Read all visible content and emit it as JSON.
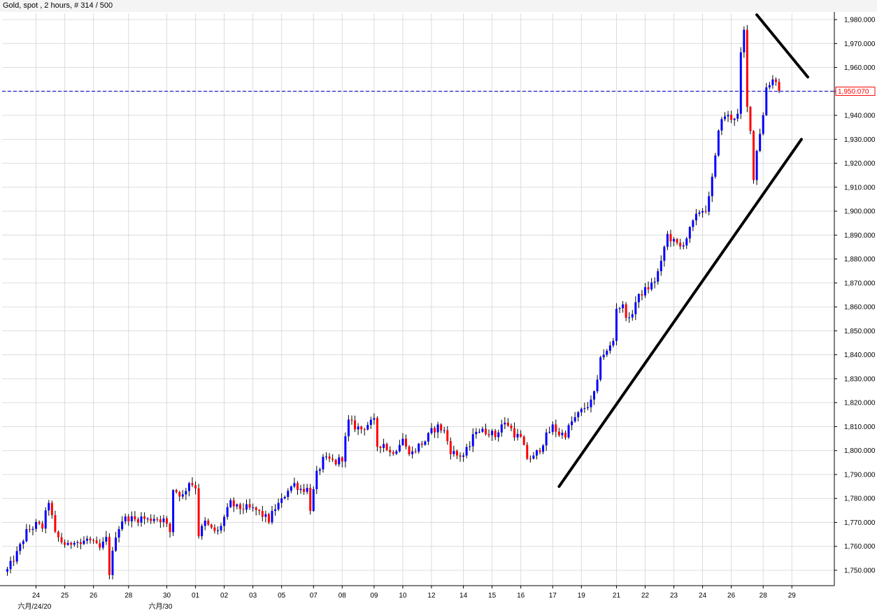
{
  "header": {
    "title": "Gold, spot , 2 hours, # 314 / 500"
  },
  "colors": {
    "bull": "#0000ff",
    "bear": "#ff0000",
    "wick": "#000000",
    "grid": "#dcdcdc",
    "price_line": "#0000cc",
    "trendline": "#000000"
  },
  "chart_data": {
    "type": "candlestick",
    "symbol": "Gold, spot",
    "timeframe": "2 hours",
    "ylim": [
      1743,
      1983
    ],
    "y_ticks": [
      1750,
      1760,
      1770,
      1780,
      1790,
      1800,
      1810,
      1820,
      1830,
      1840,
      1850,
      1860,
      1870,
      1880,
      1890,
      1900,
      1910,
      1920,
      1930,
      1940,
      1950,
      1960,
      1970,
      1980
    ],
    "y_tick_labels": [
      "1,750.000",
      "1,760.000",
      "1,770.000",
      "1,780.000",
      "1,790.000",
      "1,800.000",
      "1,810.000",
      "1,820.000",
      "1,830.000",
      "1,840.000",
      "1,850.000",
      "1,860.000",
      "1,870.000",
      "1,880.000",
      "1,890.000",
      "1,900.000",
      "1,910.000",
      "1,920.000",
      "1,930.000",
      "1,940.000",
      "1,950.000",
      "1,960.000",
      "1,970.000",
      "1,980.000"
    ],
    "current_price": 1950.07,
    "current_price_label": "1,950.070",
    "x_ticks": [
      "24",
      "25",
      "26",
      "28",
      "30",
      "01",
      "02",
      "03",
      "05",
      "07",
      "08",
      "09",
      "10",
      "12",
      "14",
      "15",
      "16",
      "17",
      "19",
      "21",
      "22",
      "23",
      "24",
      "26",
      "28",
      "29"
    ],
    "x_tick_bars": [
      9,
      18,
      27,
      38,
      50,
      59,
      68,
      77,
      86,
      96,
      105,
      115,
      124,
      133,
      143,
      152,
      161,
      171,
      180,
      191,
      200,
      209,
      218,
      227,
      237,
      246
    ],
    "month_labels": [
      {
        "label": "六月/24/20",
        "bar": 9
      },
      {
        "label": "六月/30",
        "bar": 50
      }
    ],
    "total_bars": 255,
    "trendlines": [
      {
        "from": {
          "bar": 173,
          "price": 1785
        },
        "to": {
          "bar": 249,
          "price": 1930
        }
      },
      {
        "from": {
          "bar": 235,
          "price": 1982
        },
        "to": {
          "bar": 251,
          "price": 1956
        }
      }
    ],
    "path": [
      [
        0,
        1750
      ],
      [
        3,
        1757
      ],
      [
        6,
        1766
      ],
      [
        9,
        1769
      ],
      [
        11,
        1768
      ],
      [
        13,
        1779
      ],
      [
        15,
        1765
      ],
      [
        17,
        1762
      ],
      [
        19,
        1760
      ],
      [
        21,
        1763
      ],
      [
        23,
        1761
      ],
      [
        25,
        1763
      ],
      [
        27,
        1761
      ],
      [
        29,
        1759
      ],
      [
        31,
        1763
      ],
      [
        32,
        1749
      ],
      [
        34,
        1765
      ],
      [
        36,
        1771
      ],
      [
        38,
        1772
      ],
      [
        40,
        1771
      ],
      [
        42,
        1772
      ],
      [
        44,
        1771
      ],
      [
        46,
        1772
      ],
      [
        49,
        1771
      ],
      [
        51,
        1766
      ],
      [
        52,
        1784
      ],
      [
        55,
        1781
      ],
      [
        57,
        1787
      ],
      [
        59,
        1785
      ],
      [
        60,
        1765
      ],
      [
        62,
        1770
      ],
      [
        64,
        1767
      ],
      [
        66,
        1766
      ],
      [
        68,
        1772
      ],
      [
        70,
        1778
      ],
      [
        72,
        1776
      ],
      [
        75,
        1776
      ],
      [
        78,
        1775
      ],
      [
        80,
        1773
      ],
      [
        82,
        1771
      ],
      [
        84,
        1776
      ],
      [
        86,
        1779
      ],
      [
        88,
        1784
      ],
      [
        90,
        1786
      ],
      [
        92,
        1784
      ],
      [
        94,
        1784
      ],
      [
        95,
        1776
      ],
      [
        97,
        1790
      ],
      [
        99,
        1796
      ],
      [
        101,
        1796
      ],
      [
        103,
        1795
      ],
      [
        105,
        1797
      ],
      [
        106,
        1805
      ],
      [
        107,
        1812
      ],
      [
        109,
        1810
      ],
      [
        111,
        1809
      ],
      [
        113,
        1811
      ],
      [
        115,
        1812
      ],
      [
        116,
        1802
      ],
      [
        118,
        1803
      ],
      [
        120,
        1799
      ],
      [
        122,
        1801
      ],
      [
        124,
        1805
      ],
      [
        125,
        1801
      ],
      [
        127,
        1799
      ],
      [
        129,
        1802
      ],
      [
        131,
        1804
      ],
      [
        133,
        1808
      ],
      [
        135,
        1810
      ],
      [
        137,
        1808
      ],
      [
        139,
        1800
      ],
      [
        141,
        1798
      ],
      [
        143,
        1798
      ],
      [
        145,
        1802
      ],
      [
        147,
        1809
      ],
      [
        149,
        1808
      ],
      [
        151,
        1808
      ],
      [
        153,
        1806
      ],
      [
        155,
        1811
      ],
      [
        157,
        1811
      ],
      [
        159,
        1807
      ],
      [
        161,
        1805
      ],
      [
        163,
        1797
      ],
      [
        165,
        1797
      ],
      [
        167,
        1801
      ],
      [
        169,
        1806
      ],
      [
        171,
        1810
      ],
      [
        173,
        1807
      ],
      [
        175,
        1807
      ],
      [
        177,
        1812
      ],
      [
        179,
        1815
      ],
      [
        181,
        1818
      ],
      [
        183,
        1820
      ],
      [
        185,
        1828
      ],
      [
        186,
        1840
      ],
      [
        188,
        1841
      ],
      [
        190,
        1846
      ],
      [
        191,
        1860
      ],
      [
        193,
        1860
      ],
      [
        195,
        1854
      ],
      [
        197,
        1862
      ],
      [
        199,
        1866
      ],
      [
        201,
        1868
      ],
      [
        203,
        1871
      ],
      [
        205,
        1878
      ],
      [
        206,
        1885
      ],
      [
        207,
        1890
      ],
      [
        209,
        1887
      ],
      [
        211,
        1885
      ],
      [
        213,
        1889
      ],
      [
        215,
        1895
      ],
      [
        217,
        1900
      ],
      [
        219,
        1901
      ],
      [
        220,
        1905
      ],
      [
        222,
        1922
      ],
      [
        223,
        1935
      ],
      [
        225,
        1940
      ],
      [
        227,
        1939
      ],
      [
        229,
        1940
      ],
      [
        230,
        1965
      ],
      [
        231,
        1975
      ],
      [
        232,
        1943
      ],
      [
        233,
        1935
      ],
      [
        234,
        1913
      ],
      [
        235,
        1926
      ],
      [
        237,
        1940
      ],
      [
        238,
        1952
      ],
      [
        240,
        1955
      ],
      [
        241,
        1955
      ],
      [
        242,
        1950
      ]
    ]
  }
}
